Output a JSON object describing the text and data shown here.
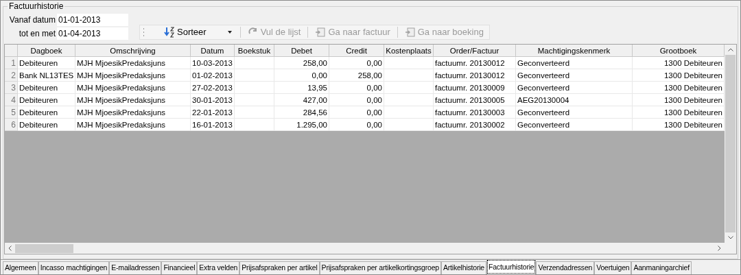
{
  "group_title": "Factuurhistorie",
  "filters": [
    {
      "label": "Vanaf datum",
      "value": "01-01-2013"
    },
    {
      "label": "tot en met",
      "value": "01-04-2013"
    }
  ],
  "toolbar": [
    {
      "kind": "sort",
      "label": "Sorteer",
      "disabled": false
    },
    {
      "kind": "fill",
      "label": "Vul de lijst",
      "disabled": true
    },
    {
      "kind": "invoice",
      "label": "Ga naar factuur",
      "disabled": true
    },
    {
      "kind": "booking",
      "label": "Ga naar boeking",
      "disabled": true
    }
  ],
  "table": {
    "columns": [
      "Dagboek",
      "Omschrijving",
      "Datum",
      "Boekstuk",
      "Debet",
      "Credit",
      "Kostenplaats",
      "Order/Factuur",
      "Machtigingskenmerk",
      "Grootboek"
    ],
    "rows": [
      {
        "number": "1",
        "cells": [
          "Debiteuren",
          "MJH MjoesikPredaksjuns",
          "10-03-2013",
          "",
          "258,00",
          "0,00",
          "",
          "factuumr. 20130012",
          "Geconverteerd",
          "1300 Debiteuren"
        ]
      },
      {
        "number": "2",
        "cells": [
          "Bank NL13TES",
          "MJH MjoesikPredaksjuns",
          "01-02-2013",
          "",
          "0,00",
          "258,00",
          "",
          "factuumr. 20130012",
          "Geconverteerd",
          "1300 Debiteuren"
        ]
      },
      {
        "number": "3",
        "cells": [
          "Debiteuren",
          "MJH MjoesikPredaksjuns",
          "27-02-2013",
          "",
          "13,95",
          "0,00",
          "",
          "factuumr. 20130009",
          "Geconverteerd",
          "1300 Debiteuren"
        ]
      },
      {
        "number": "4",
        "cells": [
          "Debiteuren",
          "MJH MjoesikPredaksjuns",
          "30-01-2013",
          "",
          "427,00",
          "0,00",
          "",
          "factuumr. 20130005",
          "AEG20130004",
          "1300 Debiteuren"
        ]
      },
      {
        "number": "5",
        "cells": [
          "Debiteuren",
          "MJH MjoesikPredaksjuns",
          "22-01-2013",
          "",
          "284,56",
          "0,00",
          "",
          "factuumr. 20130003",
          "Geconverteerd",
          "1300 Debiteuren"
        ]
      },
      {
        "number": "6",
        "cells": [
          "Debiteuren",
          "MJH MjoesikPredaksjuns",
          "16-01-2013",
          "",
          "1.295,00",
          "0,00",
          "",
          "factuumr. 20130002",
          "Geconverteerd",
          "1300 Debiteuren"
        ]
      }
    ]
  },
  "tabs": [
    {
      "label": "Algemeen",
      "selected": false
    },
    {
      "label": "Incasso machtigingen",
      "selected": false
    },
    {
      "label": "E-mailadressen",
      "selected": false
    },
    {
      "label": "Financieel",
      "selected": false
    },
    {
      "label": "Extra velden",
      "selected": false
    },
    {
      "label": "Prijsafspraken per artikel",
      "selected": false
    },
    {
      "label": "Prijsafspraken per artikelkortingsgroep",
      "selected": false
    },
    {
      "label": "Artikelhistorie",
      "selected": false
    },
    {
      "label": "Factuurhistorie",
      "selected": true
    },
    {
      "label": "Verzendadressen",
      "selected": false
    },
    {
      "label": "Voertuigen",
      "selected": false
    },
    {
      "label": "Aanmaningarchief",
      "selected": false
    }
  ]
}
